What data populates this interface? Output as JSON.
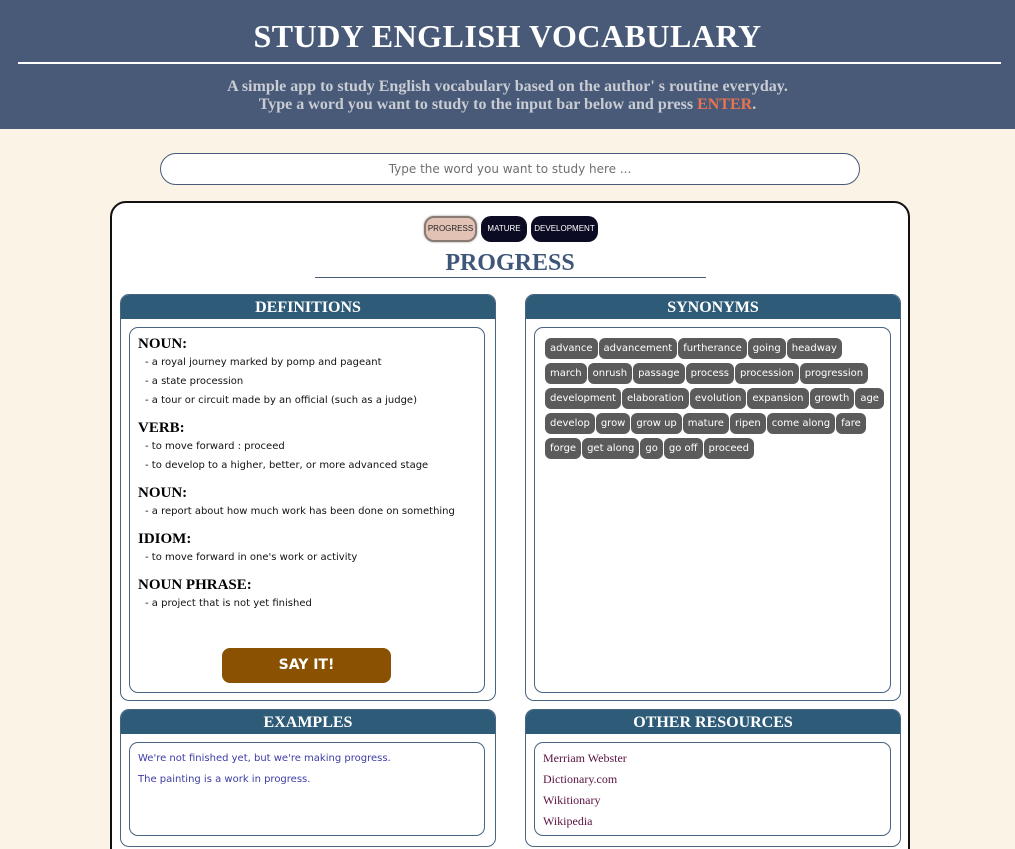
{
  "header": {
    "title": "STUDY ENGLISH VOCABULARY",
    "subtitle_line1": "A simple app to study English vocabulary based on the author' s routine everyday.",
    "subtitle_line2_prefix": "Type a word you want to study to the input bar below and press ",
    "subtitle_enter": "ENTER",
    "subtitle_suffix": "."
  },
  "search": {
    "placeholder": "Type the word you want to study here ..."
  },
  "tabs": [
    {
      "label": "PROGRESS"
    },
    {
      "label": "MATURE"
    },
    {
      "label": "DEVELOPMENT"
    }
  ],
  "word": "PROGRESS",
  "definitions": {
    "title": "DEFINITIONS",
    "groups": [
      {
        "pos": "NOUN:",
        "items": [
          "- a royal journey marked by pomp and pageant",
          "- a state procession",
          "- a tour or circuit made by an official (such as a judge)"
        ]
      },
      {
        "pos": "VERB:",
        "items": [
          "- to move forward : proceed",
          "- to develop to a higher, better, or more advanced stage"
        ]
      },
      {
        "pos": "NOUN:",
        "items": [
          "- a report about how much work has been done on something"
        ]
      },
      {
        "pos": "IDIOM:",
        "items": [
          "- to move forward in one's work or activity"
        ]
      },
      {
        "pos": "NOUN PHRASE:",
        "items": [
          "- a project that is not yet finished"
        ]
      }
    ],
    "say_button": "SAY IT!"
  },
  "synonyms": {
    "title": "SYNONYMS",
    "items": [
      "advance",
      "advancement",
      "furtherance",
      "going",
      "headway",
      "march",
      "onrush",
      "passage",
      "process",
      "procession",
      "progression",
      "development",
      "elaboration",
      "evolution",
      "expansion",
      "growth",
      "age",
      "develop",
      "grow",
      "grow up",
      "mature",
      "ripen",
      "come along",
      "fare",
      "forge",
      "get along",
      "go",
      "go off",
      "proceed"
    ]
  },
  "examples": {
    "title": "EXAMPLES",
    "items": [
      "We're not finished yet, but we're making progress.",
      "The painting is a work in progress."
    ]
  },
  "resources": {
    "title": "OTHER RESOURCES",
    "items": [
      "Merriam Webster",
      "Dictionary.com",
      "Wikitionary",
      "Wikipedia"
    ]
  }
}
